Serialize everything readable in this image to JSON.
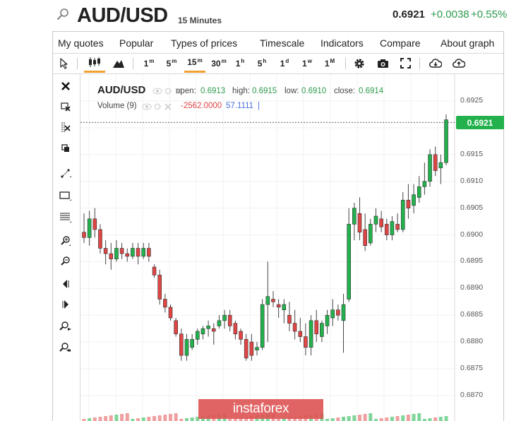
{
  "header": {
    "symbol": "AUD/USD",
    "period": "15 Minutes",
    "price": "0.6921",
    "change": "+0.0038",
    "change_pct": "+0.55%"
  },
  "menu": [
    "My quotes",
    "Popular",
    "Types of prices",
    "Timescale",
    "Indicators",
    "Compare",
    "About graph"
  ],
  "toolbar": {
    "timeframes": [
      {
        "label": "1",
        "sup": "m"
      },
      {
        "label": "5",
        "sup": "m"
      },
      {
        "label": "15",
        "sup": "m"
      },
      {
        "label": "30",
        "sup": "m"
      },
      {
        "label": "1",
        "sup": "h"
      },
      {
        "label": "5",
        "sup": "h"
      },
      {
        "label": "1",
        "sup": "d"
      },
      {
        "label": "1",
        "sup": "w"
      },
      {
        "label": "1",
        "sup": "M"
      }
    ],
    "active_timeframe": "15m",
    "icons": [
      "cursor-icon",
      "candles-icon",
      "mountain-icon",
      "gear-icon",
      "camera-icon",
      "fullscreen-icon",
      "download-icon",
      "upload-icon"
    ]
  },
  "left_tools": [
    "close-icon",
    "erase-icon",
    "erase-all-icon",
    "duplicate-icon",
    "trendline-icon",
    "rectangle-icon",
    "fibonacci-icon",
    "zoom-in-icon",
    "zoom-out-icon",
    "scroll-left-icon",
    "scroll-right-icon",
    "zoom-in-alt-icon",
    "zoom-out-alt-icon"
  ],
  "legend": {
    "symbol": "AUD/USD",
    "open_label": "open:",
    "open": "0.6913",
    "high_label": "high:",
    "high": "0.6915",
    "low_label": "low:",
    "low": "0.6910",
    "close_label": "close:",
    "close": "0.6914",
    "volume_label": "Volume (9)",
    "volume_v1": "-2562.0000",
    "volume_v2": "57.1111",
    "volume_bar": "|"
  },
  "price_tag": "0.6921",
  "watermark": "instaforex",
  "colors": {
    "up": "#22b14c",
    "down": "#e04545",
    "tag": "#22b14c"
  },
  "chart_data": {
    "type": "candlestick",
    "y_ticks": [
      "0.6925",
      "0.6920",
      "0.6915",
      "0.6910",
      "0.6905",
      "0.6900",
      "0.6895",
      "0.6890",
      "0.6885",
      "0.6880",
      "0.6875",
      "0.6870"
    ],
    "ylim": [
      0.6867,
      0.6927
    ],
    "current_price": 0.6921,
    "grid": true,
    "candles": [
      {
        "o": 0.69005,
        "h": 0.6904,
        "l": 0.68985,
        "c": 0.68995
      },
      {
        "o": 0.68995,
        "h": 0.69045,
        "l": 0.6898,
        "c": 0.6903
      },
      {
        "o": 0.6903,
        "h": 0.6905,
        "l": 0.68995,
        "c": 0.6901
      },
      {
        "o": 0.6901,
        "h": 0.6902,
        "l": 0.68965,
        "c": 0.68975
      },
      {
        "o": 0.68975,
        "h": 0.6899,
        "l": 0.68945,
        "c": 0.68965
      },
      {
        "o": 0.68965,
        "h": 0.68985,
        "l": 0.68935,
        "c": 0.68955
      },
      {
        "o": 0.68955,
        "h": 0.6899,
        "l": 0.6895,
        "c": 0.68975
      },
      {
        "o": 0.68975,
        "h": 0.68985,
        "l": 0.68955,
        "c": 0.68965
      },
      {
        "o": 0.68965,
        "h": 0.68975,
        "l": 0.6895,
        "c": 0.6896
      },
      {
        "o": 0.6896,
        "h": 0.68985,
        "l": 0.68955,
        "c": 0.68975
      },
      {
        "o": 0.68975,
        "h": 0.68985,
        "l": 0.68945,
        "c": 0.6896
      },
      {
        "o": 0.6896,
        "h": 0.68985,
        "l": 0.68955,
        "c": 0.68975
      },
      {
        "o": 0.68975,
        "h": 0.68985,
        "l": 0.6895,
        "c": 0.6896
      },
      {
        "o": 0.6894,
        "h": 0.68945,
        "l": 0.6892,
        "c": 0.68925
      },
      {
        "o": 0.68925,
        "h": 0.68935,
        "l": 0.6887,
        "c": 0.6888
      },
      {
        "o": 0.6888,
        "h": 0.6889,
        "l": 0.68855,
        "c": 0.68865
      },
      {
        "o": 0.68865,
        "h": 0.6887,
        "l": 0.6884,
        "c": 0.68845
      },
      {
        "o": 0.6884,
        "h": 0.68845,
        "l": 0.6881,
        "c": 0.68815
      },
      {
        "o": 0.68815,
        "h": 0.68825,
        "l": 0.68765,
        "c": 0.68775
      },
      {
        "o": 0.68775,
        "h": 0.68815,
        "l": 0.68765,
        "c": 0.68805
      },
      {
        "o": 0.6879,
        "h": 0.68815,
        "l": 0.68785,
        "c": 0.68805
      },
      {
        "o": 0.68805,
        "h": 0.68825,
        "l": 0.68795,
        "c": 0.6882
      },
      {
        "o": 0.68815,
        "h": 0.6883,
        "l": 0.68805,
        "c": 0.68825
      },
      {
        "o": 0.68825,
        "h": 0.6884,
        "l": 0.6881,
        "c": 0.6883
      },
      {
        "o": 0.68825,
        "h": 0.68835,
        "l": 0.68795,
        "c": 0.6882
      },
      {
        "o": 0.6883,
        "h": 0.6885,
        "l": 0.68825,
        "c": 0.6884
      },
      {
        "o": 0.6884,
        "h": 0.6886,
        "l": 0.68825,
        "c": 0.6885
      },
      {
        "o": 0.6885,
        "h": 0.6886,
        "l": 0.6882,
        "c": 0.6883
      },
      {
        "o": 0.68835,
        "h": 0.6884,
        "l": 0.68805,
        "c": 0.68815
      },
      {
        "o": 0.6882,
        "h": 0.68825,
        "l": 0.68795,
        "c": 0.68805
      },
      {
        "o": 0.68805,
        "h": 0.68815,
        "l": 0.68765,
        "c": 0.6877
      },
      {
        "o": 0.688,
        "h": 0.68815,
        "l": 0.68765,
        "c": 0.68775
      },
      {
        "o": 0.68785,
        "h": 0.688,
        "l": 0.68775,
        "c": 0.6879
      },
      {
        "o": 0.6879,
        "h": 0.6888,
        "l": 0.68785,
        "c": 0.6887
      },
      {
        "o": 0.6887,
        "h": 0.6895,
        "l": 0.688,
        "c": 0.68885
      },
      {
        "o": 0.6888,
        "h": 0.68895,
        "l": 0.68865,
        "c": 0.68875
      },
      {
        "o": 0.6887,
        "h": 0.6888,
        "l": 0.68845,
        "c": 0.68865
      },
      {
        "o": 0.6886,
        "h": 0.6888,
        "l": 0.68835,
        "c": 0.6887
      },
      {
        "o": 0.6885,
        "h": 0.68875,
        "l": 0.6882,
        "c": 0.68835
      },
      {
        "o": 0.68835,
        "h": 0.6886,
        "l": 0.68805,
        "c": 0.6882
      },
      {
        "o": 0.6882,
        "h": 0.68845,
        "l": 0.688,
        "c": 0.6881
      },
      {
        "o": 0.6881,
        "h": 0.68835,
        "l": 0.68775,
        "c": 0.6879
      },
      {
        "o": 0.6879,
        "h": 0.6885,
        "l": 0.68775,
        "c": 0.6884
      },
      {
        "o": 0.6884,
        "h": 0.6886,
        "l": 0.688,
        "c": 0.68815
      },
      {
        "o": 0.6881,
        "h": 0.6884,
        "l": 0.688,
        "c": 0.68835
      },
      {
        "o": 0.6883,
        "h": 0.6886,
        "l": 0.68815,
        "c": 0.6885
      },
      {
        "o": 0.68845,
        "h": 0.6888,
        "l": 0.6883,
        "c": 0.6886
      },
      {
        "o": 0.6886,
        "h": 0.6887,
        "l": 0.6884,
        "c": 0.6885
      },
      {
        "o": 0.6884,
        "h": 0.6889,
        "l": 0.6878,
        "c": 0.6887
      },
      {
        "o": 0.6888,
        "h": 0.6905,
        "l": 0.68875,
        "c": 0.6902
      },
      {
        "o": 0.6902,
        "h": 0.6906,
        "l": 0.6899,
        "c": 0.6905
      },
      {
        "o": 0.6904,
        "h": 0.6907,
        "l": 0.6899,
        "c": 0.69005
      },
      {
        "o": 0.6901,
        "h": 0.6904,
        "l": 0.6897,
        "c": 0.6898
      },
      {
        "o": 0.68985,
        "h": 0.6903,
        "l": 0.6898,
        "c": 0.6902
      },
      {
        "o": 0.6902,
        "h": 0.6905,
        "l": 0.69005,
        "c": 0.69035
      },
      {
        "o": 0.6903,
        "h": 0.69045,
        "l": 0.69005,
        "c": 0.69015
      },
      {
        "o": 0.6902,
        "h": 0.6903,
        "l": 0.6899,
        "c": 0.69
      },
      {
        "o": 0.69,
        "h": 0.69035,
        "l": 0.6899,
        "c": 0.69025
      },
      {
        "o": 0.6902,
        "h": 0.6904,
        "l": 0.69005,
        "c": 0.6901
      },
      {
        "o": 0.6901,
        "h": 0.6908,
        "l": 0.69005,
        "c": 0.69065
      },
      {
        "o": 0.69065,
        "h": 0.69095,
        "l": 0.6903,
        "c": 0.6905
      },
      {
        "o": 0.69055,
        "h": 0.69095,
        "l": 0.6904,
        "c": 0.69075
      },
      {
        "o": 0.6907,
        "h": 0.6911,
        "l": 0.6906,
        "c": 0.6909
      },
      {
        "o": 0.6909,
        "h": 0.69135,
        "l": 0.69075,
        "c": 0.691
      },
      {
        "o": 0.691,
        "h": 0.6916,
        "l": 0.6909,
        "c": 0.6915
      },
      {
        "o": 0.6915,
        "h": 0.69165,
        "l": 0.6911,
        "c": 0.6912
      },
      {
        "o": 0.69125,
        "h": 0.6915,
        "l": 0.69095,
        "c": 0.69135
      },
      {
        "o": 0.69135,
        "h": 0.69225,
        "l": 0.6913,
        "c": 0.69215
      }
    ]
  }
}
